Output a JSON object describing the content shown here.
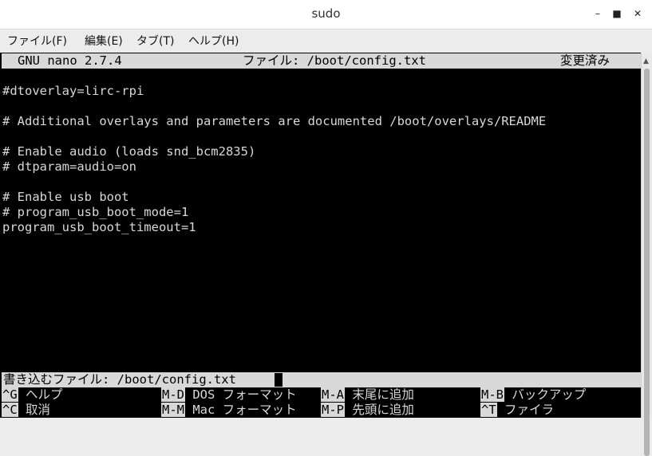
{
  "window": {
    "title": "sudo"
  },
  "menubar": {
    "items": [
      "ファイル(F)",
      "編集(E)",
      "タブ(T)",
      "ヘルプ(H)"
    ]
  },
  "nano": {
    "version": "GNU nano 2.7.4",
    "file_title": "ファイル: /boot/config.txt",
    "status": "変更済み",
    "lines": [
      "#dtoverlay=lirc-rpi",
      "# Additional overlays and parameters are documented /boot/overlays/README",
      "# Enable audio (loads snd_bcm2835)",
      "# dtparam=audio=on",
      "# Enable usb boot",
      "# program_usb_boot_mode=1",
      "program_usb_boot_timeout=1"
    ],
    "prompt": "書き込むファイル: /boot/config.txt",
    "shortcuts": [
      {
        "key": "^G",
        "label": "ヘルプ"
      },
      {
        "key": "M-D",
        "label": "DOS フォーマット"
      },
      {
        "key": "M-A",
        "label": "末尾に追加"
      },
      {
        "key": "M-B",
        "label": "バックアップ"
      },
      {
        "key": "^C",
        "label": "取消"
      },
      {
        "key": "M-M",
        "label": "Mac フォーマット"
      },
      {
        "key": "M-P",
        "label": "先頭に追加"
      },
      {
        "key": "^T",
        "label": "ファイラ"
      }
    ]
  }
}
